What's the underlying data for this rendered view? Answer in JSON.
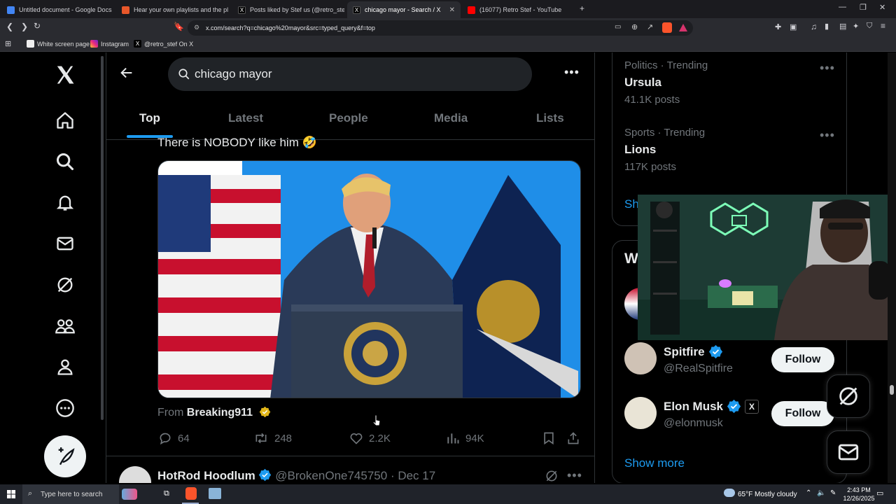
{
  "browser": {
    "tabs": [
      {
        "label": "Untitled document - Google Docs",
        "color": "#4285f4"
      },
      {
        "label": "Hear your own playlists and the play",
        "color": "#e8572a"
      },
      {
        "label": "Posts liked by Stef us (@retro_stef) /",
        "color": "#000000"
      },
      {
        "label": "chicago mayor - Search / X",
        "color": "#000000"
      },
      {
        "label": "(16077) Retro Stef - YouTube",
        "color": "#ff0000"
      }
    ],
    "url": "x.com/search?q=chicago%20mayor&src=typed_query&f=top",
    "bookmarks": [
      {
        "label": "White screen page"
      },
      {
        "label": "Instagram"
      },
      {
        "label": "@retro_stef On X"
      }
    ]
  },
  "search": {
    "query": "chicago mayor"
  },
  "search_tabs": [
    "Top",
    "Latest",
    "People",
    "Media",
    "Lists"
  ],
  "tweet": {
    "text": "There is NOBODY like him 🤣",
    "from_prefix": "From",
    "from_account": "Breaking911",
    "replies": "64",
    "reposts": "248",
    "likes": "2.2K",
    "views": "94K"
  },
  "next_tweet": {
    "name": "HotRod Hoodlum",
    "handle": "@BrokenOne745750",
    "date": "· Dec 17"
  },
  "trends": [
    {
      "category": "Politics · Trending",
      "name": "Ursula",
      "count": "41.1K posts"
    },
    {
      "category": "Sports · Trending",
      "name": "Lions",
      "count": "117K posts"
    }
  ],
  "show_link_partial": "Sh",
  "who_to_follow": {
    "heading_partial": "W",
    "accounts": [
      {
        "name": "Spitfire",
        "handle": "@RealSpitfire",
        "button": "Follow"
      },
      {
        "name": "Elon Musk",
        "handle": "@elonmusk",
        "button": "Follow"
      }
    ],
    "show_more": "Show more"
  },
  "taskbar": {
    "search_placeholder": "Type here to search",
    "weather": "65°F  Mostly cloudy",
    "time": "2:43 PM",
    "date": "12/26/2025"
  },
  "colors": {
    "accent": "#1d9bf0",
    "verified_gold": "#e2b719",
    "background": "#000000"
  }
}
